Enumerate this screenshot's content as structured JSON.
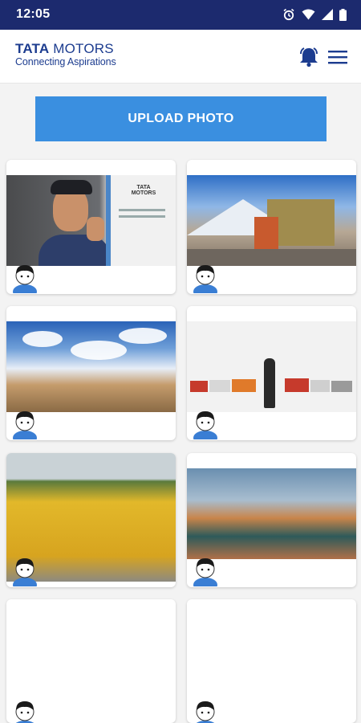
{
  "status_bar": {
    "time": "12:05"
  },
  "header": {
    "brand_name_bold": "TATA",
    "brand_name_rest": " MOTORS",
    "brand_tagline": "Connecting Aspirations",
    "notification_icon": "bell-icon",
    "menu_icon": "hamburger-menu-icon"
  },
  "upload_button": {
    "label": "UPLOAD PHOTO"
  },
  "ad_logo": {
    "name": "TATA MOTORS"
  },
  "colors": {
    "status_bar": "#1c2a6e",
    "brand": "#1c3c8f",
    "button": "#3a8fe0",
    "background": "#f3f3f3"
  },
  "gallery": {
    "cards": [
      {
        "photo": "tata-motors-ad-man-thumbs-up"
      },
      {
        "photo": "truck-in-mountains"
      },
      {
        "photo": "blue-sky-desert-road"
      },
      {
        "photo": "man-with-truck-fleet"
      },
      {
        "photo": "sunflower-field"
      },
      {
        "photo": "desert-lake-fort"
      },
      {
        "photo": "empty"
      },
      {
        "photo": "empty"
      }
    ]
  }
}
